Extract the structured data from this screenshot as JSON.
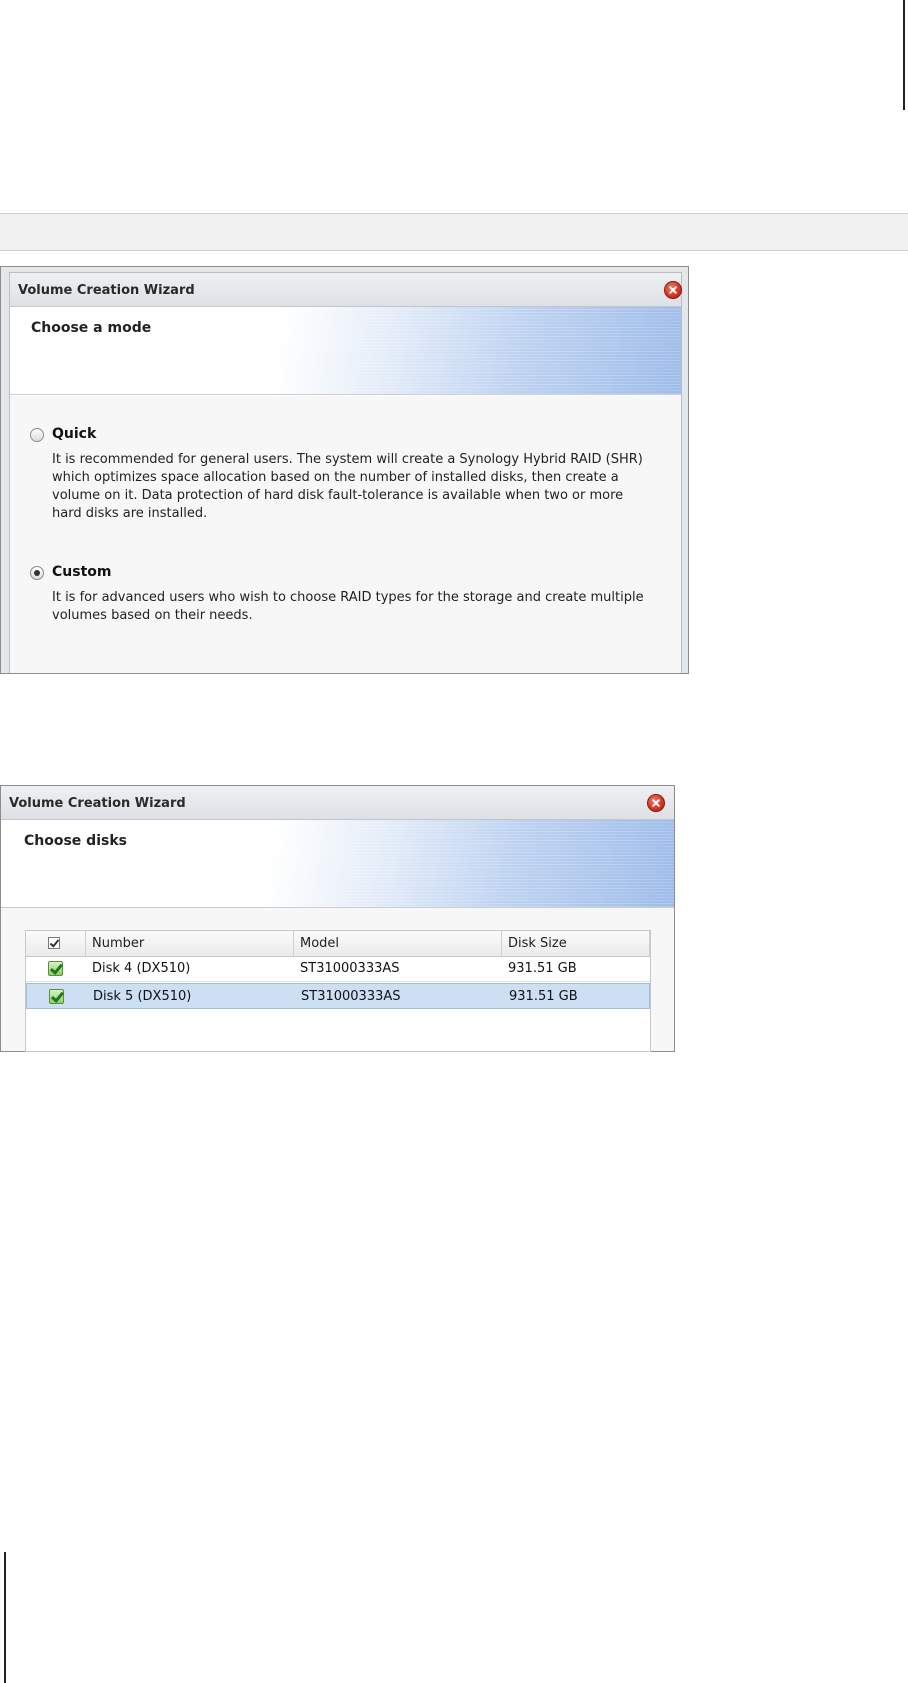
{
  "wizard_mode": {
    "title": "Volume Creation Wizard",
    "heading": "Choose a mode",
    "options": [
      {
        "label": "Quick",
        "selected": false,
        "description": "It is recommended for general users. The system will create a Synology Hybrid RAID (SHR) which optimizes space allocation based on the number of installed disks, then create a volume on it. Data protection of hard disk fault-tolerance is available when two or more hard disks are installed."
      },
      {
        "label": "Custom",
        "selected": true,
        "description": "It is for advanced users who wish to choose RAID types for the storage and create multiple volumes based on their needs."
      }
    ]
  },
  "wizard_disks": {
    "title": "Volume Creation Wizard",
    "heading": "Choose disks",
    "columns": [
      "Number",
      "Model",
      "Disk Size"
    ],
    "rows": [
      {
        "number": "Disk 4 (DX510)",
        "model": "ST31000333AS",
        "size": "931.51 GB",
        "checked": true,
        "selected": false
      },
      {
        "number": "Disk 5 (DX510)",
        "model": "ST31000333AS",
        "size": "931.51 GB",
        "checked": true,
        "selected": true
      }
    ]
  },
  "icons": {
    "close": "close-icon",
    "radio": "radio-button",
    "checkbox": "checkbox-checked-icon"
  },
  "colors": {
    "header_gradient_end": "#9dbce9",
    "selected_row": "#cddff3",
    "close_button": "#d3311f"
  }
}
